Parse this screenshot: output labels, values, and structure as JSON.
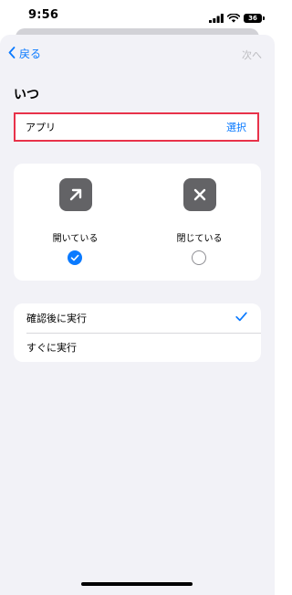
{
  "status_bar": {
    "time": "9:56",
    "battery": "36"
  },
  "nav": {
    "back_label": "戻る",
    "next_label": "次へ"
  },
  "section_title": "いつ",
  "app_row": {
    "label": "アプリ",
    "action": "選択"
  },
  "states": [
    {
      "label": "開いている",
      "icon": "arrow-up-right-icon",
      "selected": true
    },
    {
      "label": "閉じている",
      "icon": "xmark-icon",
      "selected": false
    }
  ],
  "run_options": [
    {
      "label": "確認後に実行",
      "selected": true
    },
    {
      "label": "すぐに実行",
      "selected": false
    }
  ],
  "colors": {
    "accent": "#0a7aff",
    "highlight": "#e8324a",
    "background": "#f2f2f7",
    "icon_bg": "#636366"
  }
}
